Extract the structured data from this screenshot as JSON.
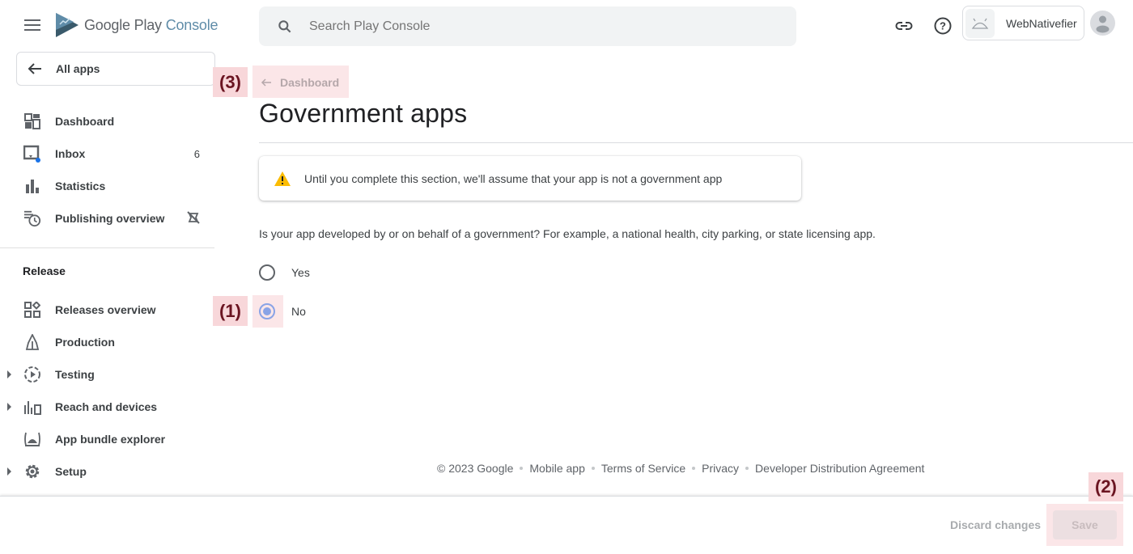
{
  "header": {
    "logo_text_main": "Google Play",
    "logo_text_accent": "Console",
    "search_placeholder": "Search Play Console",
    "developer_name": "WebNativefier"
  },
  "sidebar": {
    "all_apps_label": "All apps",
    "items": [
      {
        "label": "Dashboard",
        "icon": "dashboard-icon"
      },
      {
        "label": "Inbox",
        "icon": "inbox-icon",
        "badge": "6"
      },
      {
        "label": "Statistics",
        "icon": "bar-chart-icon"
      },
      {
        "label": "Publishing overview",
        "icon": "publishing-overview-icon",
        "trailing_icon": "managed-publishing-off-icon"
      }
    ],
    "release_section_title": "Release",
    "release_items": [
      {
        "label": "Releases overview",
        "icon": "releases-overview-icon"
      },
      {
        "label": "Production",
        "icon": "production-icon"
      },
      {
        "label": "Testing",
        "icon": "testing-icon",
        "expandable": true
      },
      {
        "label": "Reach and devices",
        "icon": "reach-devices-icon",
        "expandable": true
      },
      {
        "label": "App bundle explorer",
        "icon": "app-bundle-icon"
      },
      {
        "label": "Setup",
        "icon": "gear-icon",
        "expandable": true
      }
    ]
  },
  "main": {
    "breadcrumb_label": "Dashboard",
    "title": "Government apps",
    "warning_text": "Until you complete this section, we'll assume that your app is not a government app",
    "question": "Is your app developed by or on behalf of a government? For example, a national health, city parking, or state licensing app.",
    "options": [
      {
        "label": "Yes",
        "selected": false
      },
      {
        "label": "No",
        "selected": true
      }
    ]
  },
  "annotations": {
    "a1": "(1)",
    "a2": "(2)",
    "a3": "(3)"
  },
  "footer": {
    "copyright": "© 2023 Google",
    "links": [
      "Mobile app",
      "Terms of Service",
      "Privacy",
      "Developer Distribution Agreement"
    ]
  },
  "bottom_bar": {
    "discard_label": "Discard changes",
    "save_label": "Save"
  },
  "colors": {
    "radio_selected": "#89a3e6",
    "warning": "#fbbc04",
    "annotation_bg": "#f8d7da",
    "annotation_text": "#6b1421",
    "inbox_dot": "#1a73e8"
  }
}
